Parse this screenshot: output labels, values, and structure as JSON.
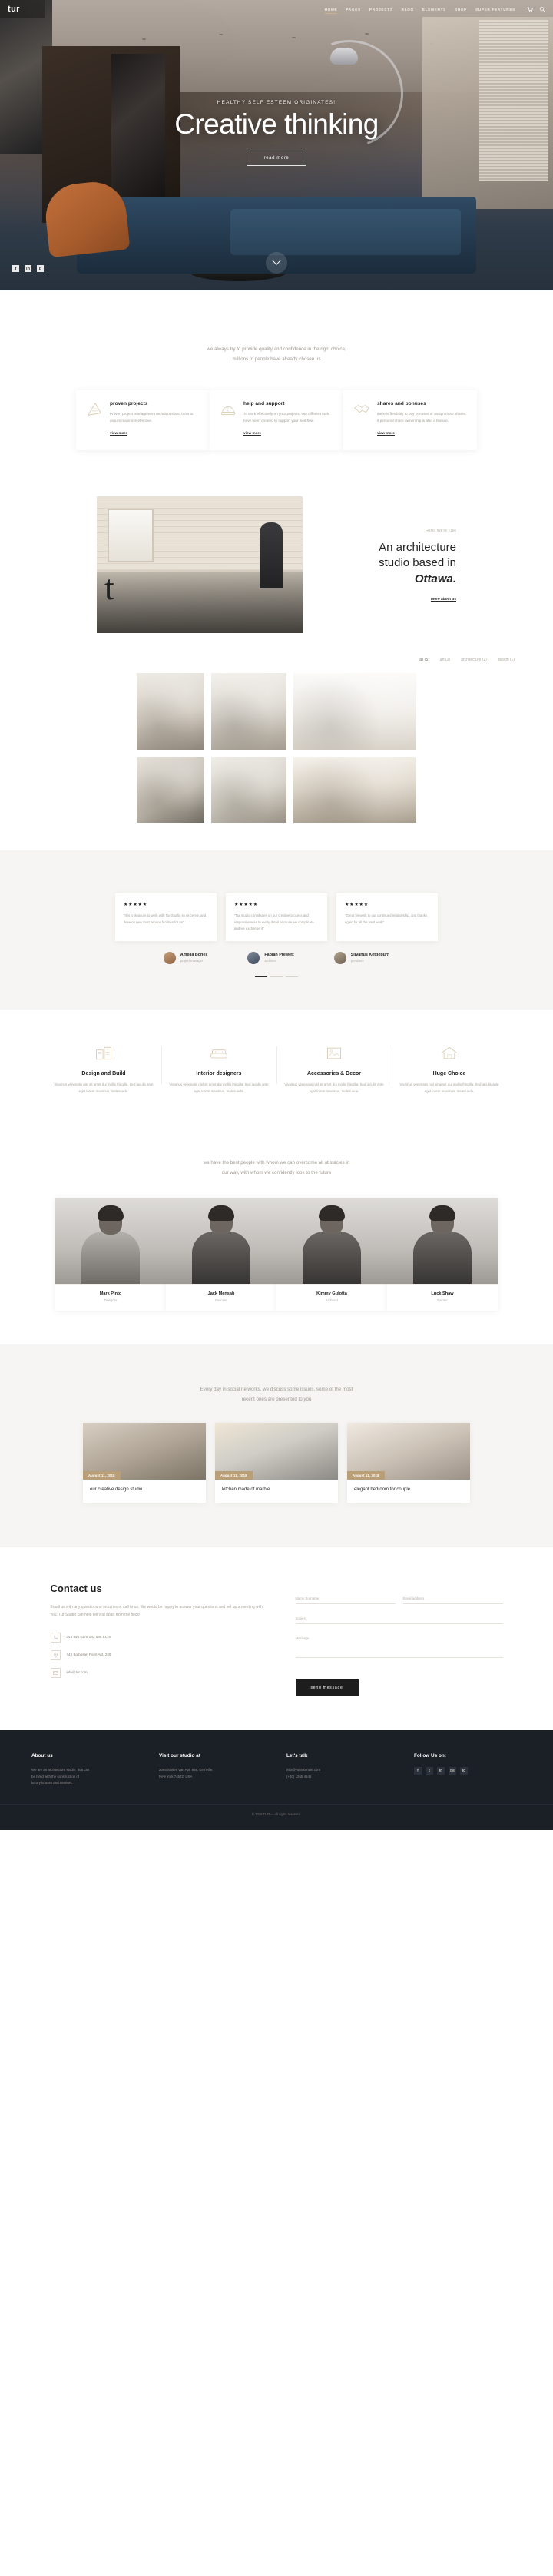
{
  "header": {
    "logo": "tur",
    "nav": [
      {
        "label": "HOME",
        "active": true
      },
      {
        "label": "PAGES",
        "active": false
      },
      {
        "label": "PROJECTS",
        "active": false
      },
      {
        "label": "BLOG",
        "active": false
      },
      {
        "label": "ELEMENTS",
        "active": false
      },
      {
        "label": "SHOP",
        "active": false
      },
      {
        "label": "SUPER FEATURES",
        "active": false
      }
    ],
    "icons": [
      "cart-icon",
      "search-icon"
    ]
  },
  "hero": {
    "kicker": "HEALTHY SELF ESTEEM ORIGINATES!",
    "title": "Creative thinking",
    "button": "read more",
    "social": [
      "f",
      "in",
      "b"
    ]
  },
  "features": {
    "intro_line1": "we always try to provide quality and confidence in the right choice,",
    "intro_line2": "millions of people have already chosen us",
    "cards": [
      {
        "icon": "ruler-icon",
        "title": "proven projects",
        "text": "Proven project management techniques and tools to assure maximize effective.",
        "link": "view more"
      },
      {
        "icon": "helmet-icon",
        "title": "help and support",
        "text": "To work effectively on your projects, two different tools have been created to support your workflow.",
        "link": "view more"
      },
      {
        "icon": "handshake-icon",
        "title": "shares and bonuses",
        "text": "there is flexibility to pay bonuses or assign more shares, if personal share ownership is also a feature.",
        "link": "view more"
      }
    ]
  },
  "about": {
    "hello": "Hello, We're TUR",
    "heading_line1": "An architecture",
    "heading_line2": "studio based in",
    "heading_em": "Ottawa.",
    "link": "more about us",
    "letter": "t"
  },
  "portfolio": {
    "filters": [
      {
        "label": "all (5)",
        "active": true
      },
      {
        "label": "art (2)",
        "active": false
      },
      {
        "label": "architecture (2)",
        "active": false
      },
      {
        "label": "design (1)",
        "active": false
      }
    ]
  },
  "testimonials": {
    "cards": [
      {
        "stars": "★★★★★",
        "text": "\"It is a pleasure to work with Tur Studio so sincerely, and develop new trust service facilities for us\""
      },
      {
        "stars": "★★★★★",
        "text": "\"Tur studio contributes on our creative process and responsiveness to every detail because we complicate and we exchange it\""
      },
      {
        "stars": "★★★★★",
        "text": "\"Great firework to our continued relationship, and thanks again for all the hard work\""
      }
    ],
    "people": [
      {
        "name": "Amelia Bones",
        "role": "project manager",
        "avatar": "avatar-amelia"
      },
      {
        "name": "Fabian Prewett",
        "role": "architect",
        "avatar": "avatar-fabian"
      },
      {
        "name": "Silvanus Kettleburn",
        "role": "president",
        "avatar": "avatar-silvanus"
      }
    ],
    "dots": [
      true,
      false,
      false
    ]
  },
  "services": [
    {
      "icon": "building-icon",
      "title": "Design and Build",
      "text": "Vivamus venenatis nisl sit amet dui mollis fringilla. Sed iaculis ante eget lorem maximus, malesuada."
    },
    {
      "icon": "sofa-icon",
      "title": "Interior designers",
      "text": "Vivamus venenatis nisl sit amet dui mollis fringilla. Sed iaculis ante eget lorem maximus, malesuada."
    },
    {
      "icon": "frame-icon",
      "title": "Accessories & Decor",
      "text": "Vivamus venenatis nisl sit amet dui mollis fringilla. Sed iaculis ante eget lorem maximus, malesuada."
    },
    {
      "icon": "home-icon",
      "title": "Huge Choice",
      "text": "Vivamus venenatis nisl sit amet dui mollis fringilla. Sed iaculis ante eget lorem maximus, malesuada."
    }
  ],
  "team": {
    "intro_line1": "we have the best people with whom we can overcome all obstacles in",
    "intro_line2": "our way, with whom we confidently look to the future",
    "members": [
      {
        "name": "Mark Pinto",
        "role": "Designer"
      },
      {
        "name": "Jack Mensah",
        "role": "Founder"
      },
      {
        "name": "Kimmy Gulotta",
        "role": "Architect"
      },
      {
        "name": "Luck Shaw",
        "role": "Painter"
      }
    ]
  },
  "blog": {
    "intro_line1": "Every day in social networks, we discuss some issues, some of the most",
    "intro_line2": "recent ones are presented to you",
    "posts": [
      {
        "date": "August 11, 2018",
        "title": "our creative design studio"
      },
      {
        "date": "August 11, 2018",
        "title": "kitchen made of marble"
      },
      {
        "date": "August 11, 2018",
        "title": "elegant bedroom for couple"
      }
    ]
  },
  "contact": {
    "heading": "Contact us",
    "text": "Email us with any questions or inquiries or call to us. We would be happy to answer your questions and set up a meeting with you. Tur Studio can help tell you apart from the flock!",
    "items": [
      {
        "icon": "phone-icon",
        "text": "043 546 5178    042 546 5178"
      },
      {
        "icon": "pin-icon",
        "text": "742 Bolbosan Point Apt. 229"
      },
      {
        "icon": "mail-icon",
        "text": "info@tur.com"
      }
    ],
    "form": {
      "name_label": "Name Surname",
      "email_label": "Email address",
      "subject_label": "Subject",
      "message_label": "Message",
      "submit": "send message"
    }
  },
  "footer": {
    "columns": [
      {
        "title": "About us",
        "lines": [
          "We are an architecture studio, that can",
          "be hired with the construction of",
          "luxury houses and interiors."
        ]
      },
      {
        "title": "Visit our studio at",
        "lines": [
          "2065 Sixties Van Apt. 856, Kernville,",
          "New York 74572, USA"
        ]
      },
      {
        "title": "Let's talk",
        "lines": [
          "info@yourdomain.com",
          "(+40) 1265 4545"
        ]
      },
      {
        "title": "Follow Us on:",
        "social": [
          "f",
          "t",
          "in",
          "be",
          "ig"
        ]
      }
    ],
    "copyright": "© 2018 TUR — All rights reserved."
  },
  "colors": {
    "accent": "#b99f78",
    "dark": "#1b1f26",
    "muted": "#a7a29b"
  }
}
